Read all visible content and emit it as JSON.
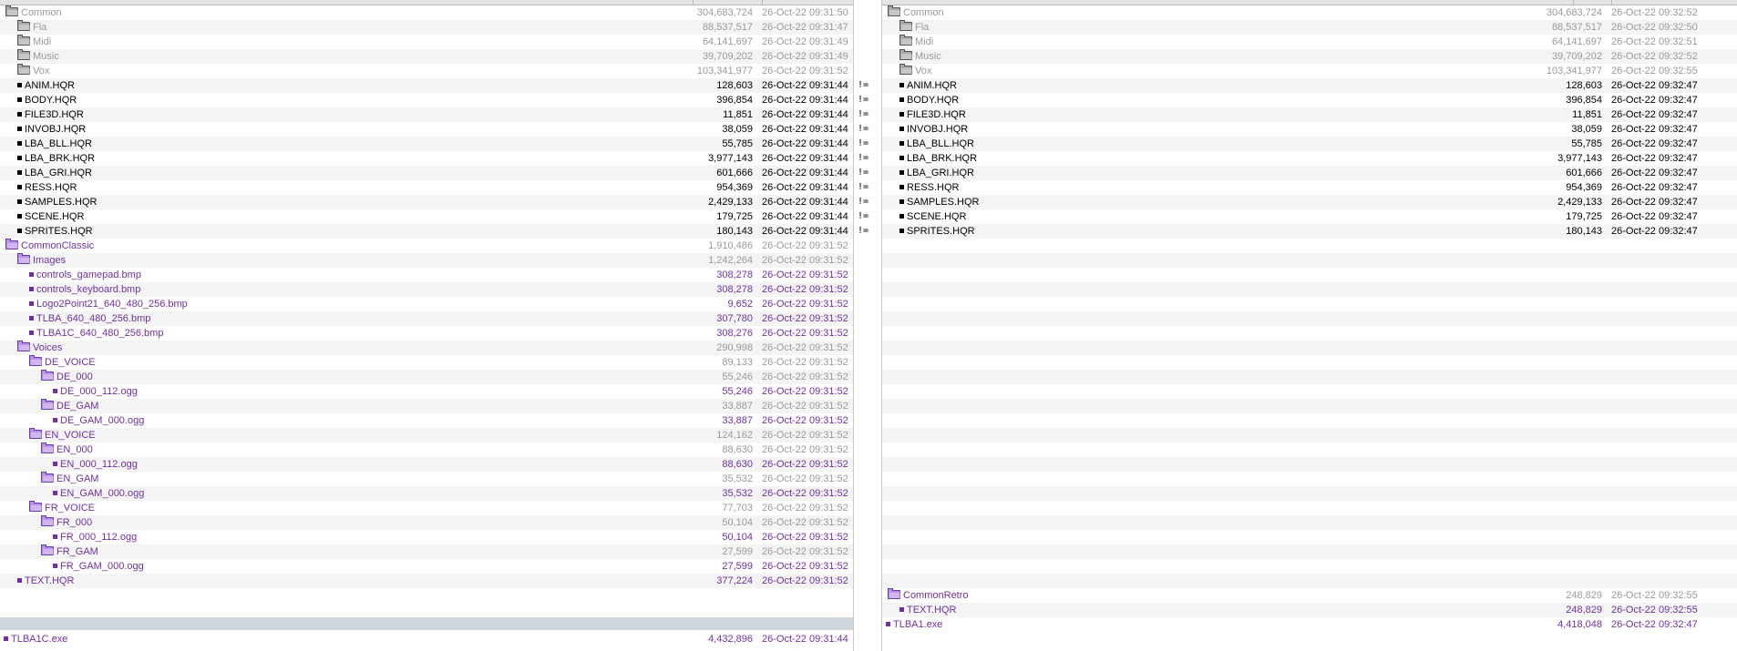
{
  "left": {
    "rows": [
      {
        "name": "Common",
        "size": "304,683,724",
        "date": "26-Oct-22 09:31:50",
        "kind": "folder",
        "color": "gray",
        "indent": 0
      },
      {
        "name": "Fla",
        "size": "88,537,517",
        "date": "26-Oct-22 09:31:47",
        "kind": "folder",
        "color": "gray",
        "indent": 1
      },
      {
        "name": "Midi",
        "size": "64,141,697",
        "date": "26-Oct-22 09:31:49",
        "kind": "folder",
        "color": "gray",
        "indent": 1
      },
      {
        "name": "Music",
        "size": "39,709,202",
        "date": "26-Oct-22 09:31:49",
        "kind": "folder",
        "color": "gray",
        "indent": 1
      },
      {
        "name": "Vox",
        "size": "103,341,977",
        "date": "26-Oct-22 09:31:52",
        "kind": "folder",
        "color": "gray",
        "indent": 1
      },
      {
        "name": "ANIM.HQR",
        "size": "128,603",
        "date": "26-Oct-22 09:31:44",
        "kind": "file",
        "color": "black",
        "indent": 1,
        "mark": "!="
      },
      {
        "name": "BODY.HQR",
        "size": "396,854",
        "date": "26-Oct-22 09:31:44",
        "kind": "file",
        "color": "black",
        "indent": 1,
        "mark": "!="
      },
      {
        "name": "FILE3D.HQR",
        "size": "11,851",
        "date": "26-Oct-22 09:31:44",
        "kind": "file",
        "color": "black",
        "indent": 1,
        "mark": "!="
      },
      {
        "name": "INVOBJ.HQR",
        "size": "38,059",
        "date": "26-Oct-22 09:31:44",
        "kind": "file",
        "color": "black",
        "indent": 1,
        "mark": "!="
      },
      {
        "name": "LBA_BLL.HQR",
        "size": "55,785",
        "date": "26-Oct-22 09:31:44",
        "kind": "file",
        "color": "black",
        "indent": 1,
        "mark": "!="
      },
      {
        "name": "LBA_BRK.HQR",
        "size": "3,977,143",
        "date": "26-Oct-22 09:31:44",
        "kind": "file",
        "color": "black",
        "indent": 1,
        "mark": "!="
      },
      {
        "name": "LBA_GRI.HQR",
        "size": "601,666",
        "date": "26-Oct-22 09:31:44",
        "kind": "file",
        "color": "black",
        "indent": 1,
        "mark": "!="
      },
      {
        "name": "RESS.HQR",
        "size": "954,369",
        "date": "26-Oct-22 09:31:44",
        "kind": "file",
        "color": "black",
        "indent": 1,
        "mark": "!="
      },
      {
        "name": "SAMPLES.HQR",
        "size": "2,429,133",
        "date": "26-Oct-22 09:31:44",
        "kind": "file",
        "color": "black",
        "indent": 1,
        "mark": "!="
      },
      {
        "name": "SCENE.HQR",
        "size": "179,725",
        "date": "26-Oct-22 09:31:44",
        "kind": "file",
        "color": "black",
        "indent": 1,
        "mark": "!="
      },
      {
        "name": "SPRITES.HQR",
        "size": "180,143",
        "date": "26-Oct-22 09:31:44",
        "kind": "file",
        "color": "black",
        "indent": 1,
        "mark": "!="
      },
      {
        "name": "CommonClassic",
        "size": "1,910,486",
        "date": "26-Oct-22 09:31:52",
        "kind": "folder",
        "color": "purple",
        "indent": 0,
        "sizeGray": true
      },
      {
        "name": "Images",
        "size": "1,242,264",
        "date": "26-Oct-22 09:31:52",
        "kind": "folder",
        "color": "purple",
        "indent": 1,
        "sizeGray": true
      },
      {
        "name": "controls_gamepad.bmp",
        "size": "308,278",
        "date": "26-Oct-22 09:31:52",
        "kind": "file",
        "color": "purple",
        "indent": 2
      },
      {
        "name": "controls_keyboard.bmp",
        "size": "308,278",
        "date": "26-Oct-22 09:31:52",
        "kind": "file",
        "color": "purple",
        "indent": 2
      },
      {
        "name": "Logo2Point21_640_480_256.bmp",
        "size": "9,652",
        "date": "26-Oct-22 09:31:52",
        "kind": "file",
        "color": "purple",
        "indent": 2
      },
      {
        "name": "TLBA_640_480_256.bmp",
        "size": "307,780",
        "date": "26-Oct-22 09:31:52",
        "kind": "file",
        "color": "purple",
        "indent": 2
      },
      {
        "name": "TLBA1C_640_480_256.bmp",
        "size": "308,276",
        "date": "26-Oct-22 09:31:52",
        "kind": "file",
        "color": "purple",
        "indent": 2
      },
      {
        "name": "Voices",
        "size": "290,998",
        "date": "26-Oct-22 09:31:52",
        "kind": "folder",
        "color": "purple",
        "indent": 1,
        "sizeGray": true
      },
      {
        "name": "DE_VOICE",
        "size": "89,133",
        "date": "26-Oct-22 09:31:52",
        "kind": "folder",
        "color": "purple",
        "indent": 2,
        "sizeGray": true
      },
      {
        "name": "DE_000",
        "size": "55,246",
        "date": "26-Oct-22 09:31:52",
        "kind": "folder",
        "color": "purple",
        "indent": 3,
        "sizeGray": true
      },
      {
        "name": "DE_000_112.ogg",
        "size": "55,246",
        "date": "26-Oct-22 09:31:52",
        "kind": "file",
        "color": "purple",
        "indent": 4
      },
      {
        "name": "DE_GAM",
        "size": "33,887",
        "date": "26-Oct-22 09:31:52",
        "kind": "folder",
        "color": "purple",
        "indent": 3,
        "sizeGray": true
      },
      {
        "name": "DE_GAM_000.ogg",
        "size": "33,887",
        "date": "26-Oct-22 09:31:52",
        "kind": "file",
        "color": "purple",
        "indent": 4
      },
      {
        "name": "EN_VOICE",
        "size": "124,162",
        "date": "26-Oct-22 09:31:52",
        "kind": "folder",
        "color": "purple",
        "indent": 2,
        "sizeGray": true
      },
      {
        "name": "EN_000",
        "size": "88,630",
        "date": "26-Oct-22 09:31:52",
        "kind": "folder",
        "color": "purple",
        "indent": 3,
        "sizeGray": true
      },
      {
        "name": "EN_000_112.ogg",
        "size": "88,630",
        "date": "26-Oct-22 09:31:52",
        "kind": "file",
        "color": "purple",
        "indent": 4
      },
      {
        "name": "EN_GAM",
        "size": "35,532",
        "date": "26-Oct-22 09:31:52",
        "kind": "folder",
        "color": "purple",
        "indent": 3,
        "sizeGray": true
      },
      {
        "name": "EN_GAM_000.ogg",
        "size": "35,532",
        "date": "26-Oct-22 09:31:52",
        "kind": "file",
        "color": "purple",
        "indent": 4
      },
      {
        "name": "FR_VOICE",
        "size": "77,703",
        "date": "26-Oct-22 09:31:52",
        "kind": "folder",
        "color": "purple",
        "indent": 2,
        "sizeGray": true
      },
      {
        "name": "FR_000",
        "size": "50,104",
        "date": "26-Oct-22 09:31:52",
        "kind": "folder",
        "color": "purple",
        "indent": 3,
        "sizeGray": true
      },
      {
        "name": "FR_000_112.ogg",
        "size": "50,104",
        "date": "26-Oct-22 09:31:52",
        "kind": "file",
        "color": "purple",
        "indent": 4
      },
      {
        "name": "FR_GAM",
        "size": "27,599",
        "date": "26-Oct-22 09:31:52",
        "kind": "folder",
        "color": "purple",
        "indent": 3,
        "sizeGray": true
      },
      {
        "name": "FR_GAM_000.ogg",
        "size": "27,599",
        "date": "26-Oct-22 09:31:52",
        "kind": "file",
        "color": "purple",
        "indent": 4
      },
      {
        "name": "TEXT.HQR",
        "size": "377,224",
        "date": "26-Oct-22 09:31:52",
        "kind": "file",
        "color": "purple",
        "indent": 1
      }
    ],
    "footer": {
      "name": "TLBA1C.exe",
      "size": "4,432,896",
      "date": "26-Oct-22 09:31:44"
    }
  },
  "right": {
    "rows": [
      {
        "name": "Common",
        "size": "304,683,724",
        "date": "26-Oct-22 09:32:52",
        "kind": "folder",
        "color": "gray",
        "indent": 0
      },
      {
        "name": "Fla",
        "size": "88,537,517",
        "date": "26-Oct-22 09:32:50",
        "kind": "folder",
        "color": "gray",
        "indent": 1
      },
      {
        "name": "Midi",
        "size": "64,141,697",
        "date": "26-Oct-22 09:32:51",
        "kind": "folder",
        "color": "gray",
        "indent": 1
      },
      {
        "name": "Music",
        "size": "39,709,202",
        "date": "26-Oct-22 09:32:52",
        "kind": "folder",
        "color": "gray",
        "indent": 1
      },
      {
        "name": "Vox",
        "size": "103,341,977",
        "date": "26-Oct-22 09:32:55",
        "kind": "folder",
        "color": "gray",
        "indent": 1
      },
      {
        "name": "ANIM.HQR",
        "size": "128,603",
        "date": "26-Oct-22 09:32:47",
        "kind": "file",
        "color": "black",
        "indent": 1
      },
      {
        "name": "BODY.HQR",
        "size": "396,854",
        "date": "26-Oct-22 09:32:47",
        "kind": "file",
        "color": "black",
        "indent": 1
      },
      {
        "name": "FILE3D.HQR",
        "size": "11,851",
        "date": "26-Oct-22 09:32:47",
        "kind": "file",
        "color": "black",
        "indent": 1
      },
      {
        "name": "INVOBJ.HQR",
        "size": "38,059",
        "date": "26-Oct-22 09:32:47",
        "kind": "file",
        "color": "black",
        "indent": 1
      },
      {
        "name": "LBA_BLL.HQR",
        "size": "55,785",
        "date": "26-Oct-22 09:32:47",
        "kind": "file",
        "color": "black",
        "indent": 1
      },
      {
        "name": "LBA_BRK.HQR",
        "size": "3,977,143",
        "date": "26-Oct-22 09:32:47",
        "kind": "file",
        "color": "black",
        "indent": 1
      },
      {
        "name": "LBA_GRI.HQR",
        "size": "601,666",
        "date": "26-Oct-22 09:32:47",
        "kind": "file",
        "color": "black",
        "indent": 1
      },
      {
        "name": "RESS.HQR",
        "size": "954,369",
        "date": "26-Oct-22 09:32:47",
        "kind": "file",
        "color": "black",
        "indent": 1
      },
      {
        "name": "SAMPLES.HQR",
        "size": "2,429,133",
        "date": "26-Oct-22 09:32:47",
        "kind": "file",
        "color": "black",
        "indent": 1
      },
      {
        "name": "SCENE.HQR",
        "size": "179,725",
        "date": "26-Oct-22 09:32:47",
        "kind": "file",
        "color": "black",
        "indent": 1
      },
      {
        "name": "SPRITES.HQR",
        "size": "180,143",
        "date": "26-Oct-22 09:32:47",
        "kind": "file",
        "color": "black",
        "indent": 1
      }
    ],
    "retro": [
      {
        "name": "CommonRetro",
        "size": "248,829",
        "date": "26-Oct-22 09:32:55",
        "kind": "folder",
        "color": "purple",
        "indent": 0,
        "sizeGray": true
      },
      {
        "name": "TEXT.HQR",
        "size": "248,829",
        "date": "26-Oct-22 09:32:55",
        "kind": "file",
        "color": "purple",
        "indent": 1
      }
    ],
    "footer": {
      "name": "TLBA1.exe",
      "size": "4,418,048",
      "date": "26-Oct-22 09:32:47"
    }
  }
}
